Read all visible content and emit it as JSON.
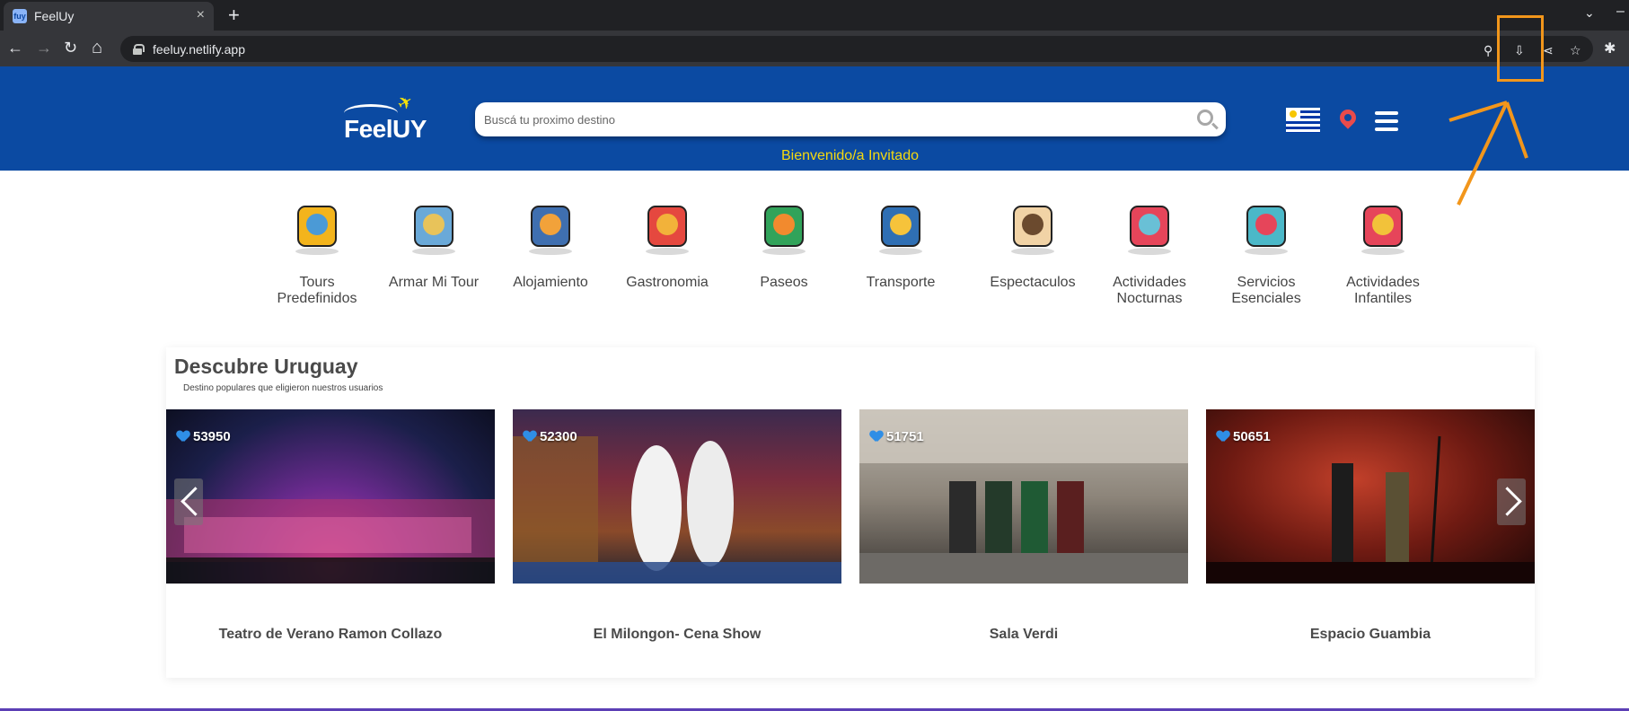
{
  "browser": {
    "tab_title": "FeelUy",
    "tab_favicon_text": "fuy",
    "close_tab": "×",
    "new_tab": "+",
    "tab_menu": "⌄",
    "minimize": "–",
    "url": "feeluy.netlify.app",
    "back": "←",
    "forward": "→",
    "reload": "↻",
    "home": "⌂",
    "location": "⚲",
    "install": "⇩",
    "share": "⋖",
    "bookmark": "☆",
    "extensions": "✱"
  },
  "header": {
    "logo_text": "FeelUY",
    "logo_plane": "✈",
    "search_placeholder": "Buscá tu proximo destino",
    "welcome": "Bienvenido/a Invitado"
  },
  "categories": [
    {
      "label": "Tours Predefinidos",
      "icon": "map-pin-road-icon"
    },
    {
      "label": "Armar Mi Tour",
      "icon": "folded-map-icon"
    },
    {
      "label": "Alojamiento",
      "icon": "hotel-icon"
    },
    {
      "label": "Gastronomia",
      "icon": "fast-food-icon"
    },
    {
      "label": "Paseos",
      "icon": "beach-island-icon"
    },
    {
      "label": "Transporte",
      "icon": "bus-icon"
    },
    {
      "label": "Espectaculos",
      "icon": "theater-masks-icon"
    },
    {
      "label": "Actividades Nocturnas",
      "icon": "cocktail-icon"
    },
    {
      "label": "Servicios Esenciales",
      "icon": "24h-phone-icon"
    },
    {
      "label": "Actividades Infantiles",
      "icon": "carousel-icon"
    }
  ],
  "discover": {
    "title": "Descubre Uruguay",
    "subtitle": "Destino populares que eligieron nuestros usuarios",
    "cards": [
      {
        "name": "Teatro de Verano Ramon Collazo",
        "likes": "53950"
      },
      {
        "name": "El Milongon- Cena Show",
        "likes": "52300"
      },
      {
        "name": "Sala Verdi",
        "likes": "51751"
      },
      {
        "name": "Espacio Guambia",
        "likes": "50651"
      }
    ]
  },
  "colors": {
    "header_blue": "#0b4aa2",
    "welcome_yellow": "#f5d90f",
    "annotation_orange": "#f2961b"
  }
}
